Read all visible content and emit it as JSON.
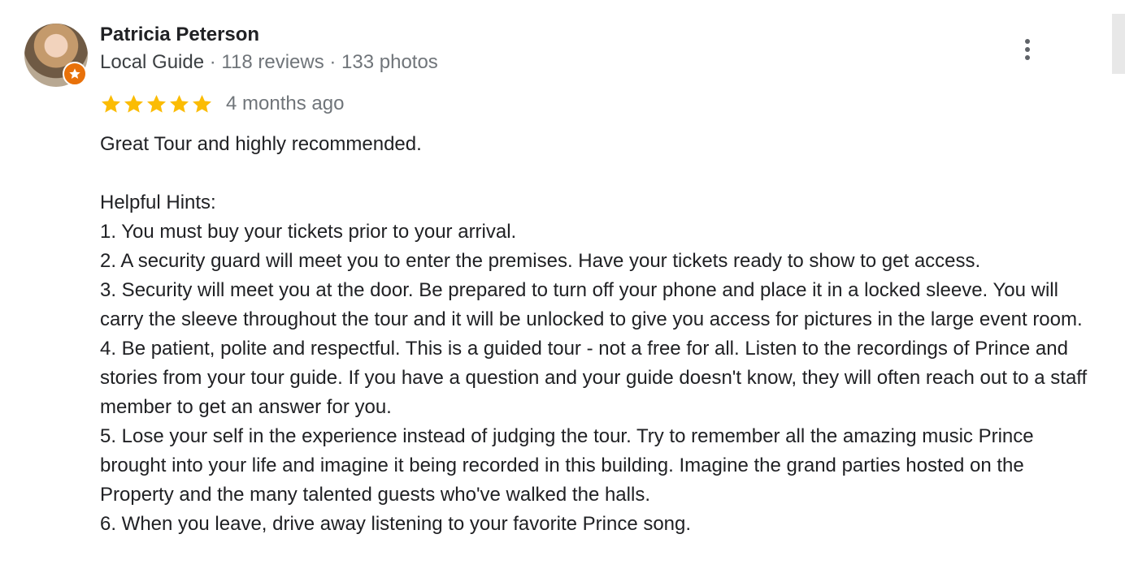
{
  "review": {
    "author": "Patricia Peterson",
    "badge": "Local Guide",
    "reviews": "118 reviews",
    "photos": "133 photos",
    "separator": " · ",
    "rating": 5,
    "date": "4 months ago",
    "text": "Great Tour and highly recommended.\n\nHelpful Hints:\n1.  You must buy your tickets prior to your arrival.\n2.  A security guard will meet you to enter the premises.  Have your tickets ready to show to get access.\n3.  Security will meet you at the door.  Be prepared to turn off your phone and place it in a locked sleeve.  You will carry the sleeve throughout the tour and it will be unlocked to give you access for pictures in the large event room.\n4.  Be patient, polite and respectful.  This is a guided tour - not a free for all.  Listen to the recordings of Prince and stories from your tour guide.  If you have a question and your guide doesn't know, they will often reach out to a staff member to get an answer for you.\n5.  Lose your self in the experience instead of judging the tour.  Try to remember all the amazing music Prince brought into your life and imagine it being recorded in this building.  Imagine the grand parties hosted on the Property and the many talented guests who've walked the halls.\n6.  When you leave, drive away listening to your favorite Prince song."
  },
  "colors": {
    "star": "#fbbc04",
    "badge": "#e8710a",
    "secondary_text": "#70757a",
    "primary_text": "#202124"
  },
  "icons": {
    "more": "more-vert-icon",
    "star": "star-icon",
    "badge": "local-guide-badge-icon"
  }
}
